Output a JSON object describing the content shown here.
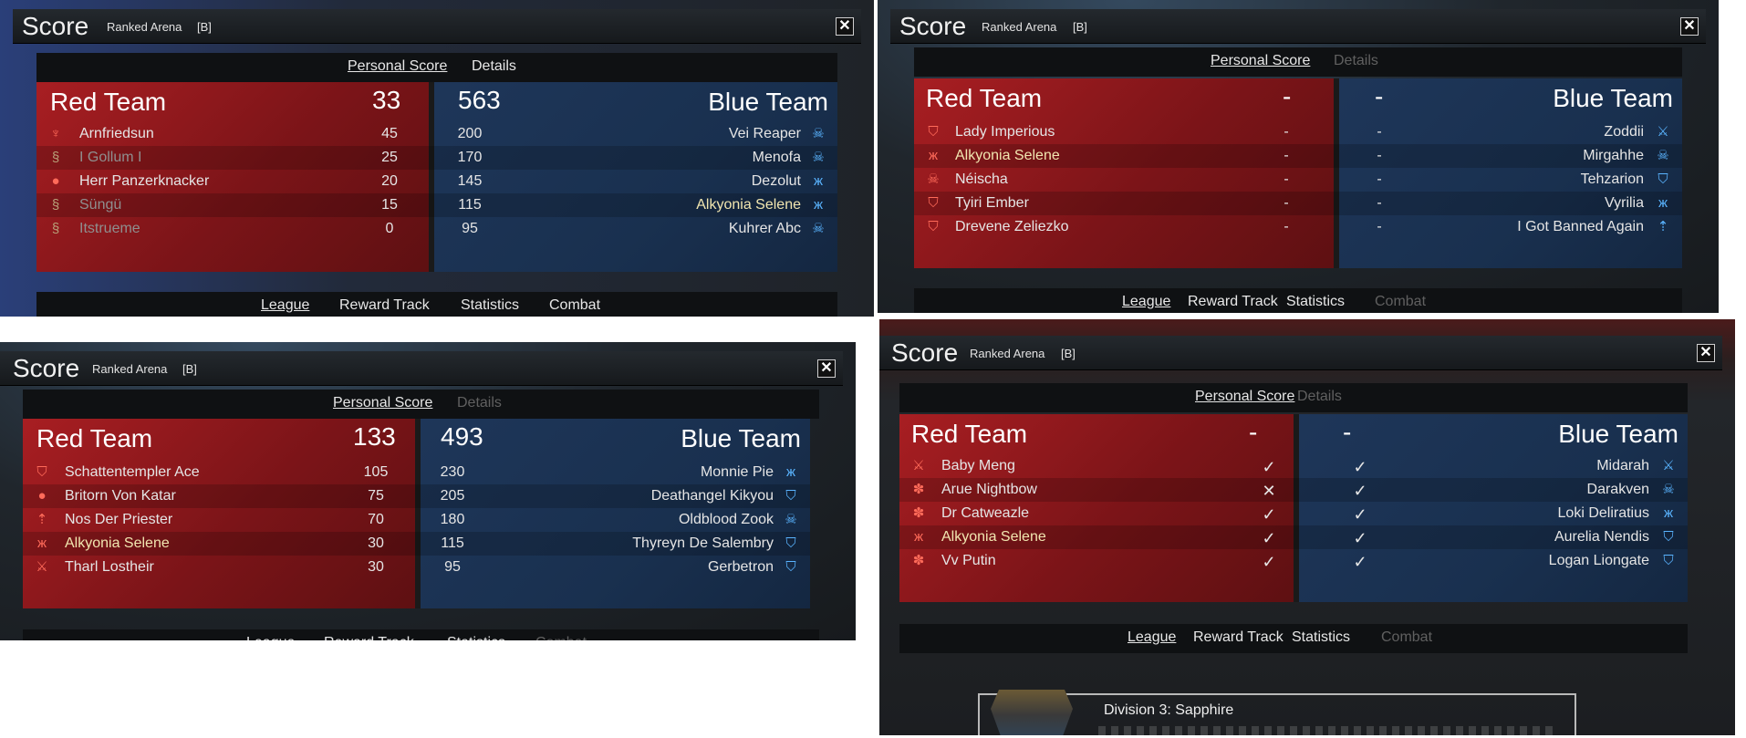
{
  "window_title": "Score",
  "mode": "Ranked Arena",
  "tag": "[B]",
  "close_glyph": "✕",
  "tabs_top": [
    "Personal Score",
    "Details"
  ],
  "tabs_bottom": [
    "League",
    "Reward Track",
    "Statistics",
    "Combat"
  ],
  "red_team": "Red Team",
  "blue_team": "Blue Team",
  "panels": [
    {
      "red_total": "33",
      "blue_total": "563",
      "red": [
        {
          "name": "Arnfriedsun",
          "score": "45",
          "icon": "wings-icon"
        },
        {
          "name": "I Gollum I",
          "score": "25",
          "icon": "spiral-icon"
        },
        {
          "name": "Herr Panzerknacker",
          "score": "20",
          "icon": "flask-icon"
        },
        {
          "name": "Süngü",
          "score": "15",
          "icon": "spiral-icon"
        },
        {
          "name": "Itstrueme",
          "score": "0",
          "icon": "spiral-icon"
        }
      ],
      "blue": [
        {
          "name": "Vei Reaper",
          "score": "200",
          "icon": "skull-icon"
        },
        {
          "name": "Menofa",
          "score": "170",
          "icon": "skull-icon"
        },
        {
          "name": "Dezolut",
          "score": "145",
          "icon": "butterfly-icon"
        },
        {
          "name": "Alkyonia Selene",
          "score": "115",
          "icon": "butterfly-icon"
        },
        {
          "name": "Kuhrer Abc",
          "score": "95",
          "icon": "skull-icon"
        }
      ]
    },
    {
      "red_total": "-",
      "blue_total": "-",
      "red": [
        {
          "name": "Lady Imperious",
          "score": "-",
          "icon": "shield-icon"
        },
        {
          "name": "Alkyonia Selene",
          "score": "-",
          "icon": "butterfly-icon"
        },
        {
          "name": "Néischa",
          "score": "-",
          "icon": "skull-icon"
        },
        {
          "name": "Tyiri Ember",
          "score": "-",
          "icon": "shield-icon"
        },
        {
          "name": "Drevene Zeliezko",
          "score": "-",
          "icon": "shield-icon"
        }
      ],
      "blue": [
        {
          "name": "Zoddii",
          "score": "-",
          "icon": "swords-icon"
        },
        {
          "name": "Mirgahhe",
          "score": "-",
          "icon": "skull-icon"
        },
        {
          "name": "Tehzarion",
          "score": "-",
          "icon": "shield-icon"
        },
        {
          "name": "Vyrilia",
          "score": "-",
          "icon": "butterfly-icon"
        },
        {
          "name": "I Got Banned Again",
          "score": "-",
          "icon": "spear-icon"
        }
      ]
    },
    {
      "red_total": "133",
      "blue_total": "493",
      "red": [
        {
          "name": "Schattentempler Ace",
          "score": "105",
          "icon": "shield-icon"
        },
        {
          "name": "Britorn Von Katar",
          "score": "75",
          "icon": "flask-icon"
        },
        {
          "name": "Nos Der Priester",
          "score": "70",
          "icon": "spear-icon"
        },
        {
          "name": "Alkyonia Selene",
          "score": "30",
          "icon": "butterfly-icon"
        },
        {
          "name": "Tharl Lostheir",
          "score": "30",
          "icon": "swords-icon"
        }
      ],
      "blue": [
        {
          "name": "Monnie Pie",
          "score": "230",
          "icon": "butterfly-icon"
        },
        {
          "name": "Deathangel Kikyou",
          "score": "205",
          "icon": "shield-icon"
        },
        {
          "name": "Oldblood Zook",
          "score": "180",
          "icon": "skull-icon"
        },
        {
          "name": "Thyreyn De Salembry",
          "score": "115",
          "icon": "shield-icon"
        },
        {
          "name": "Gerbetron",
          "score": "95",
          "icon": "shield-icon"
        }
      ]
    },
    {
      "red_total": "-",
      "blue_total": "-",
      "red": [
        {
          "name": "Baby Meng",
          "score": "✓",
          "icon": "swords-icon"
        },
        {
          "name": "Arue Nightbow",
          "score": "✕",
          "icon": "paw-icon"
        },
        {
          "name": "Dr Catweazle",
          "score": "✓",
          "icon": "paw-icon"
        },
        {
          "name": "Alkyonia Selene",
          "score": "✓",
          "icon": "butterfly-icon"
        },
        {
          "name": "Vv Putin",
          "score": "✓",
          "icon": "paw-icon"
        }
      ],
      "blue": [
        {
          "name": "Midarah",
          "score": "✓",
          "icon": "swords-icon"
        },
        {
          "name": "Darakven",
          "score": "✓",
          "icon": "skull-icon"
        },
        {
          "name": "Loki Deliratius",
          "score": "✓",
          "icon": "butterfly-icon"
        },
        {
          "name": "Aurelia Nendis",
          "score": "✓",
          "icon": "shield-icon"
        },
        {
          "name": "Logan Liongate",
          "score": "✓",
          "icon": "shield-icon"
        }
      ]
    }
  ],
  "division_label": "Division 3: Sapphire",
  "colors": {
    "red": "#a81e22",
    "blue": "#1e3659",
    "bg": "#1b1e21"
  }
}
